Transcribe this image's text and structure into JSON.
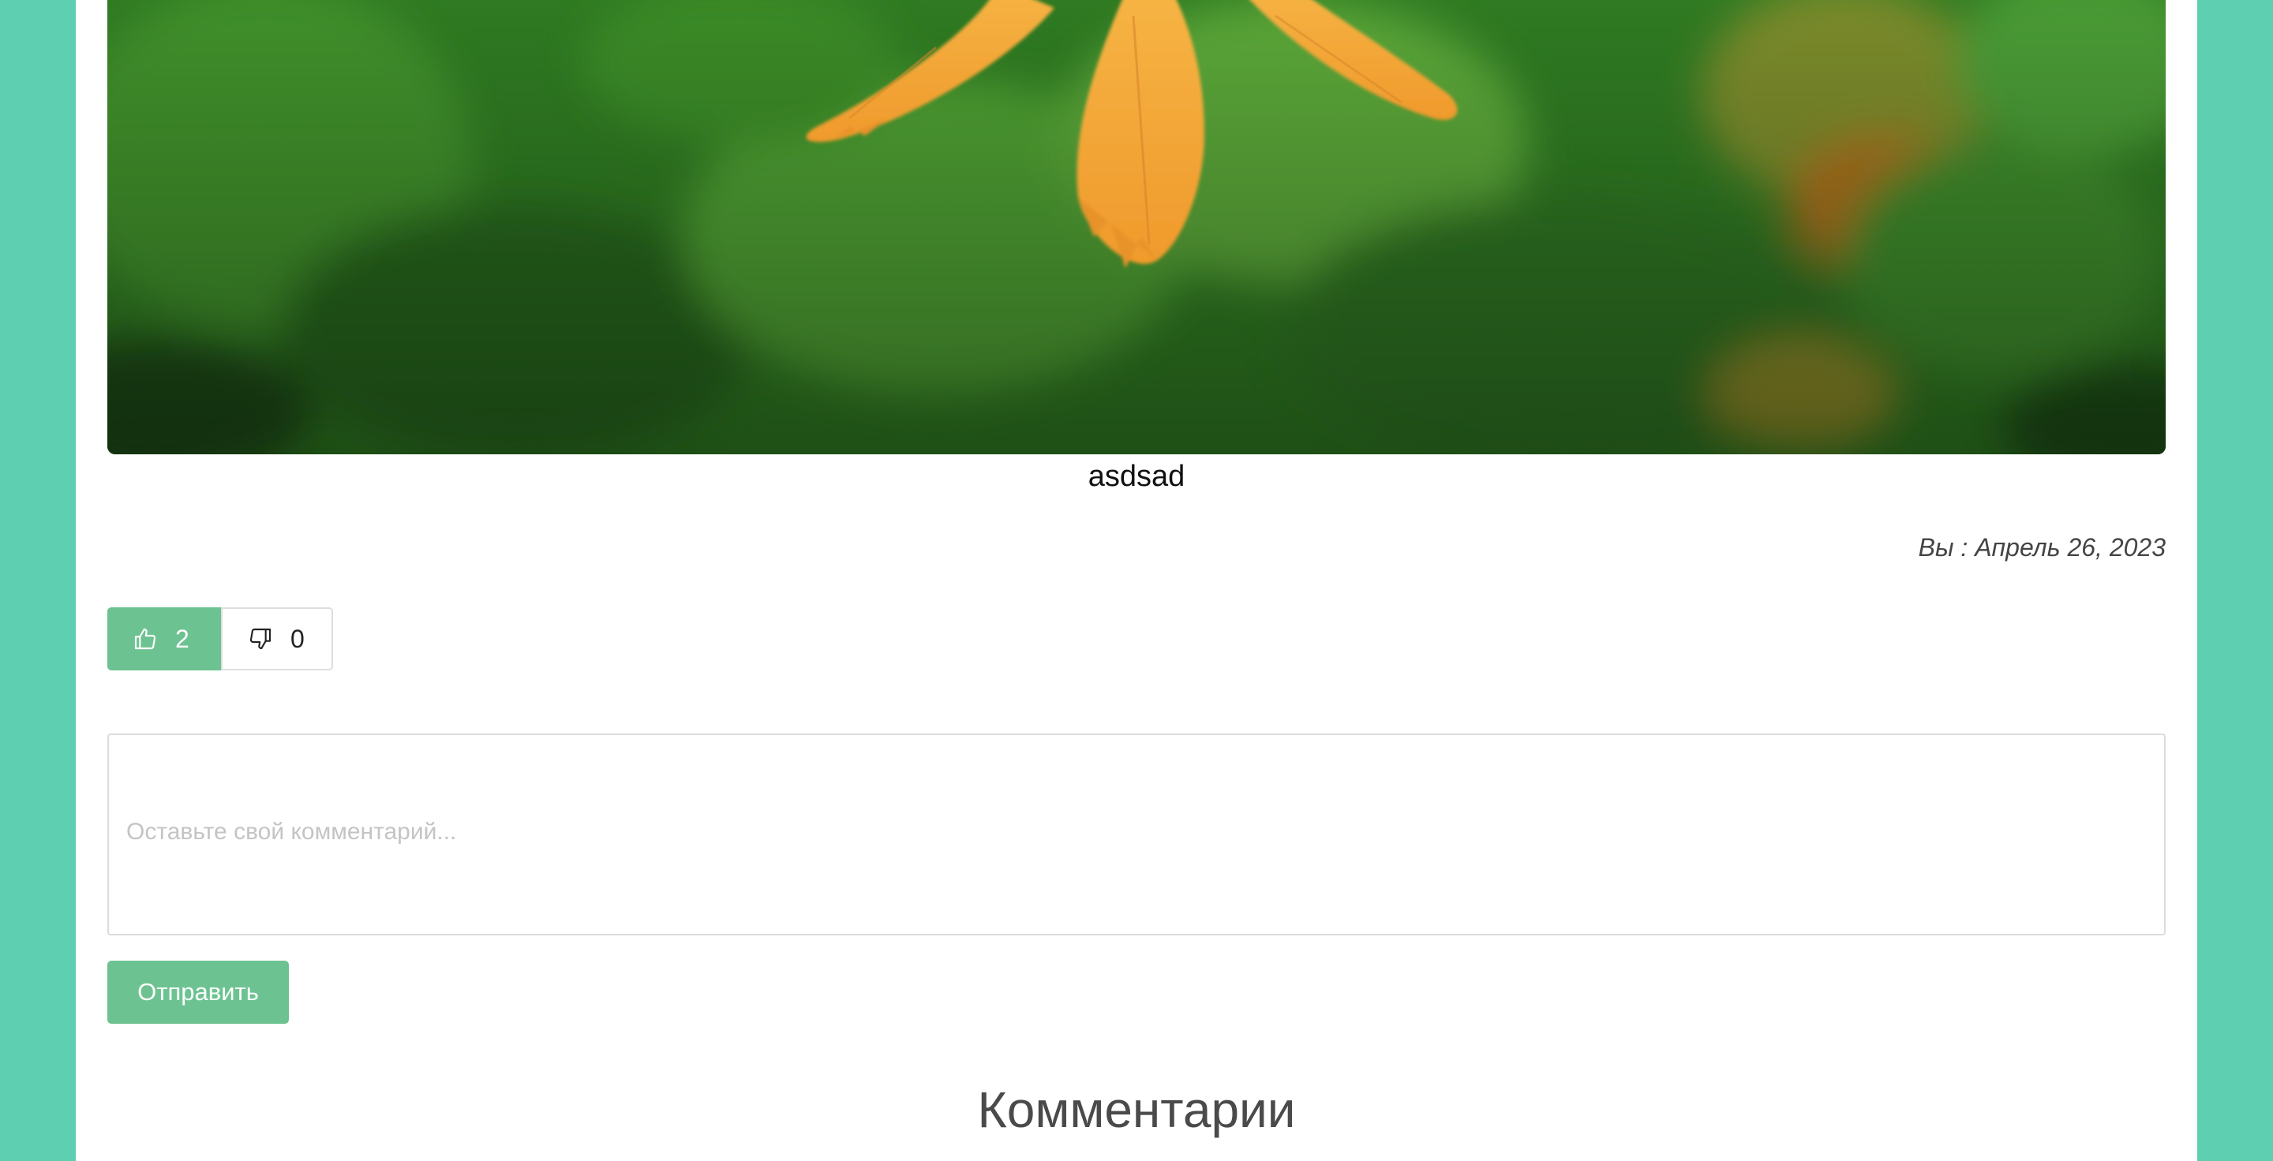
{
  "post": {
    "caption": "asdsad",
    "meta": "Вы : Апрель 26, 2023",
    "image_alt": "flower-photo"
  },
  "votes": {
    "likes": "2",
    "dislikes": "0",
    "like_icon": "thumbs-up-icon",
    "dislike_icon": "thumbs-down-icon"
  },
  "comment_form": {
    "placeholder": "Оставьте свой комментарий...",
    "value": "",
    "submit_label": "Отправить"
  },
  "comments": {
    "title": "Комментарии"
  },
  "colors": {
    "background": "#5ecfb1",
    "accent": "#6cc391",
    "petal": "#f4a93a"
  }
}
